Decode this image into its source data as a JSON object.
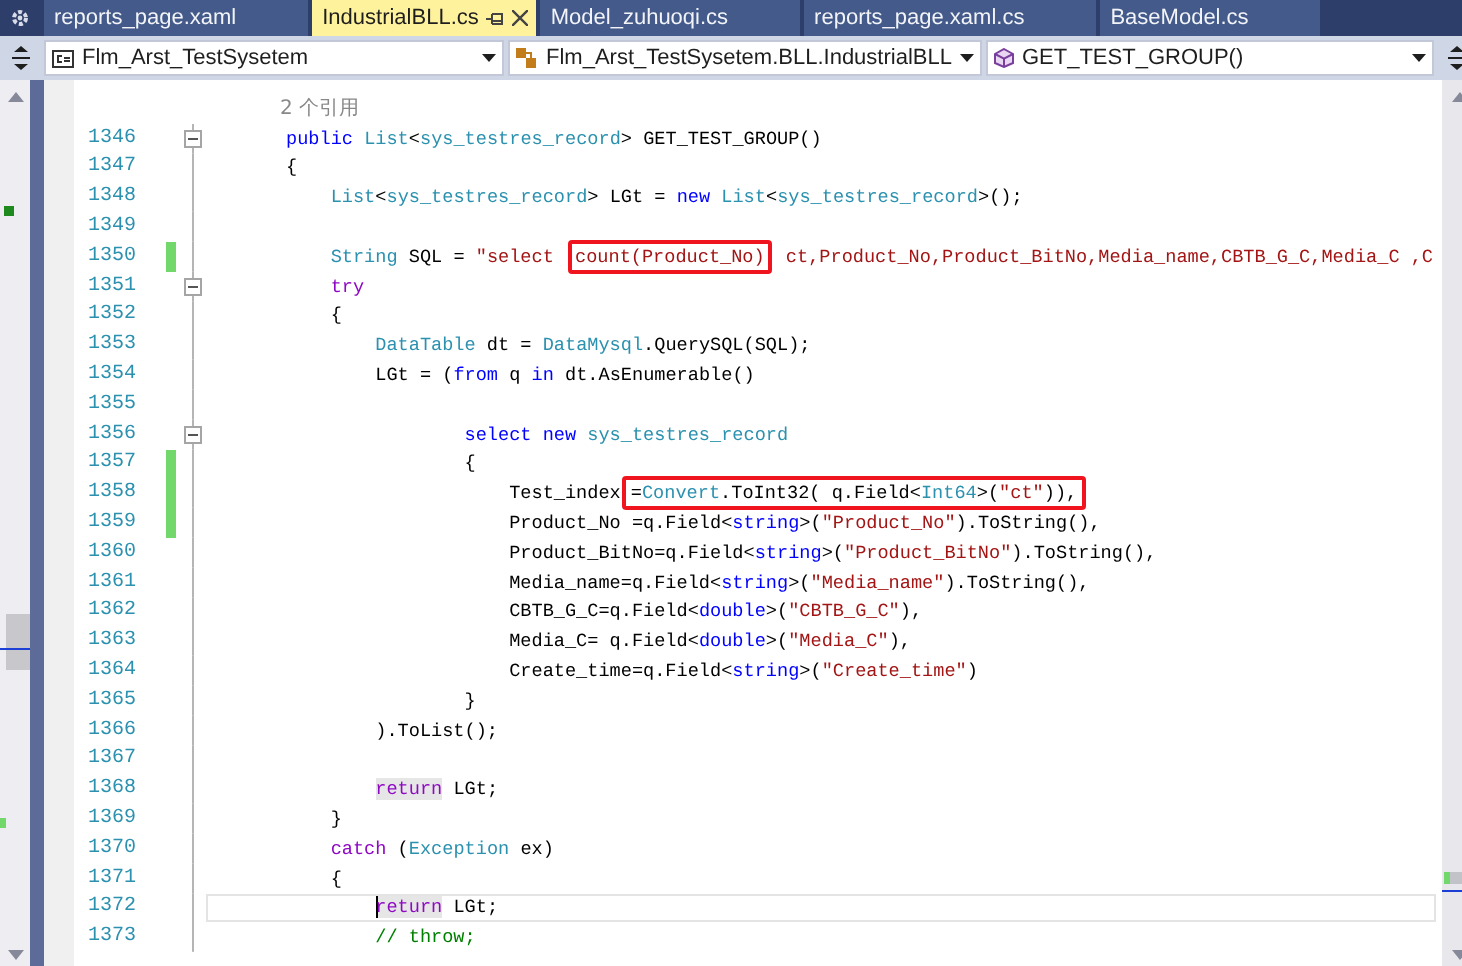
{
  "tabs": [
    {
      "label": "reports_page.xaml",
      "selected": false
    },
    {
      "label": "IndustrialBLL.cs",
      "selected": true
    },
    {
      "label": "Model_zuhuoqi.cs",
      "selected": false
    },
    {
      "label": "reports_page.xaml.cs",
      "selected": false
    },
    {
      "label": "BaseModel.cs",
      "selected": false
    }
  ],
  "navigation": {
    "project": "Flm_Arst_TestSysetem",
    "class": "Flm_Arst_TestSysetem.BLL.IndustrialBLL",
    "member": "GET_TEST_GROUP()"
  },
  "editor": {
    "codelens": "2 个引用",
    "lines": [
      {
        "number": "1346",
        "changed": false,
        "fold": true,
        "current": false,
        "tokens": [
          {
            "text": "public ",
            "kind": "keyword"
          },
          {
            "text": "List",
            "kind": "type"
          },
          {
            "text": "<",
            "kind": "plain"
          },
          {
            "text": "sys_testres_record",
            "kind": "type"
          },
          {
            "text": "> GET_TEST_GROUP()",
            "kind": "plain"
          }
        ]
      },
      {
        "number": "1347",
        "changed": false,
        "fold": false,
        "current": false,
        "tokens": [
          {
            "text": "{",
            "kind": "plain"
          }
        ]
      },
      {
        "number": "1348",
        "changed": false,
        "fold": false,
        "current": false,
        "tokens": [
          {
            "text": "    List",
            "kind": "type"
          },
          {
            "text": "<",
            "kind": "plain"
          },
          {
            "text": "sys_testres_record",
            "kind": "type"
          },
          {
            "text": "> LGt = ",
            "kind": "plain"
          },
          {
            "text": "new ",
            "kind": "keyword"
          },
          {
            "text": "List",
            "kind": "type"
          },
          {
            "text": "<",
            "kind": "plain"
          },
          {
            "text": "sys_testres_record",
            "kind": "type"
          },
          {
            "text": ">();",
            "kind": "plain"
          }
        ]
      },
      {
        "number": "1349",
        "changed": false,
        "fold": false,
        "current": false
      },
      {
        "number": "1350",
        "changed": true,
        "fold": false,
        "current": false,
        "tokens": [
          {
            "text": "    String",
            "kind": "type"
          },
          {
            "text": " SQL = ",
            "kind": "plain"
          },
          {
            "text": "\"select ",
            "kind": "string"
          },
          {
            "kind": "callout",
            "tokens": [
              {
                "text": "count(Product_No)",
                "kind": "string"
              }
            ]
          },
          {
            "text": " ct,Product_No,Product_BitNo,Media_name,CBTB_G_C,Media_C ,C",
            "kind": "string"
          }
        ]
      },
      {
        "number": "1351",
        "changed": false,
        "fold": true,
        "current": false,
        "tokens": [
          {
            "text": "    try",
            "kind": "control"
          }
        ]
      },
      {
        "number": "1352",
        "changed": false,
        "fold": false,
        "current": false,
        "tokens": [
          {
            "text": "    {",
            "kind": "plain"
          }
        ]
      },
      {
        "number": "1353",
        "changed": false,
        "fold": false,
        "current": false,
        "tokens": [
          {
            "text": "        DataTable",
            "kind": "type"
          },
          {
            "text": " dt = ",
            "kind": "plain"
          },
          {
            "text": "DataMysql",
            "kind": "type"
          },
          {
            "text": ".QuerySQL(SQL);",
            "kind": "plain"
          }
        ]
      },
      {
        "number": "1354",
        "changed": false,
        "fold": false,
        "current": false,
        "tokens": [
          {
            "text": "        LGt = (",
            "kind": "plain"
          },
          {
            "text": "from ",
            "kind": "keyword"
          },
          {
            "text": "q ",
            "kind": "plain"
          },
          {
            "text": "in ",
            "kind": "keyword"
          },
          {
            "text": "dt.AsEnumerable()",
            "kind": "plain"
          }
        ]
      },
      {
        "number": "1355",
        "changed": false,
        "fold": false,
        "current": false
      },
      {
        "number": "1356",
        "changed": false,
        "fold": true,
        "current": false,
        "tokens": [
          {
            "text": "                select new ",
            "kind": "keyword"
          },
          {
            "text": "sys_testres_record",
            "kind": "type"
          }
        ]
      },
      {
        "number": "1357",
        "changed": true,
        "fold": false,
        "current": false,
        "tokens": [
          {
            "text": "                {",
            "kind": "plain"
          }
        ]
      },
      {
        "number": "1358",
        "changed": true,
        "fold": false,
        "current": false,
        "tokens": [
          {
            "text": "                    Test_index",
            "kind": "plain"
          },
          {
            "kind": "callout",
            "tokens": [
              {
                "text": "=",
                "kind": "plain"
              },
              {
                "text": "Convert",
                "kind": "type"
              },
              {
                "text": ".ToInt32( q.Field<",
                "kind": "plain"
              },
              {
                "text": "Int64",
                "kind": "type"
              },
              {
                "text": ">(",
                "kind": "plain"
              },
              {
                "text": "\"ct\"",
                "kind": "string"
              },
              {
                "text": ")),",
                "kind": "plain"
              }
            ]
          }
        ]
      },
      {
        "number": "1359",
        "changed": true,
        "fold": false,
        "current": false,
        "tokens": [
          {
            "text": "                    Product_No =q.Field<",
            "kind": "plain"
          },
          {
            "text": "string",
            "kind": "keyword"
          },
          {
            "text": ">(",
            "kind": "plain"
          },
          {
            "text": "\"Product_No\"",
            "kind": "string"
          },
          {
            "text": ").ToString(),",
            "kind": "plain"
          }
        ]
      },
      {
        "number": "1360",
        "changed": false,
        "fold": false,
        "current": false,
        "tokens": [
          {
            "text": "                    Product_BitNo=q.Field<",
            "kind": "plain"
          },
          {
            "text": "string",
            "kind": "keyword"
          },
          {
            "text": ">(",
            "kind": "plain"
          },
          {
            "text": "\"Product_BitNo\"",
            "kind": "string"
          },
          {
            "text": ").ToString(),",
            "kind": "plain"
          }
        ]
      },
      {
        "number": "1361",
        "changed": false,
        "fold": false,
        "current": false,
        "tokens": [
          {
            "text": "                    Media_name=q.Field<",
            "kind": "plain"
          },
          {
            "text": "string",
            "kind": "keyword"
          },
          {
            "text": ">(",
            "kind": "plain"
          },
          {
            "text": "\"Media_name\"",
            "kind": "string"
          },
          {
            "text": ").ToString(),",
            "kind": "plain"
          }
        ]
      },
      {
        "number": "1362",
        "changed": false,
        "fold": false,
        "current": false,
        "tokens": [
          {
            "text": "                    CBTB_G_C=q.Field<",
            "kind": "plain"
          },
          {
            "text": "double",
            "kind": "keyword"
          },
          {
            "text": ">(",
            "kind": "plain"
          },
          {
            "text": "\"CBTB_G_C\"",
            "kind": "string"
          },
          {
            "text": "),",
            "kind": "plain"
          }
        ]
      },
      {
        "number": "1363",
        "changed": false,
        "fold": false,
        "current": false,
        "tokens": [
          {
            "text": "                    Media_C= q.Field<",
            "kind": "plain"
          },
          {
            "text": "double",
            "kind": "keyword"
          },
          {
            "text": ">(",
            "kind": "plain"
          },
          {
            "text": "\"Media_C\"",
            "kind": "string"
          },
          {
            "text": "),",
            "kind": "plain"
          }
        ]
      },
      {
        "number": "1364",
        "changed": false,
        "fold": false,
        "current": false,
        "tokens": [
          {
            "text": "                    Create_time=q.Field<",
            "kind": "plain"
          },
          {
            "text": "string",
            "kind": "keyword"
          },
          {
            "text": ">(",
            "kind": "plain"
          },
          {
            "text": "\"Create_time\"",
            "kind": "string"
          },
          {
            "text": ")",
            "kind": "plain"
          }
        ]
      },
      {
        "number": "1365",
        "changed": false,
        "fold": false,
        "current": false,
        "tokens": [
          {
            "text": "                }",
            "kind": "plain"
          }
        ]
      },
      {
        "number": "1366",
        "changed": false,
        "fold": false,
        "current": false,
        "tokens": [
          {
            "text": "        ).ToList();",
            "kind": "plain"
          }
        ]
      },
      {
        "number": "1367",
        "changed": false,
        "fold": false,
        "current": false
      },
      {
        "number": "1368",
        "changed": false,
        "fold": false,
        "current": false,
        "tokens": [
          {
            "text": "        return",
            "kind": "control-ref"
          },
          {
            "text": " LGt;",
            "kind": "plain"
          }
        ]
      },
      {
        "number": "1369",
        "changed": false,
        "fold": false,
        "current": false,
        "tokens": [
          {
            "text": "    }",
            "kind": "plain"
          }
        ]
      },
      {
        "number": "1370",
        "changed": false,
        "fold": false,
        "current": false,
        "tokens": [
          {
            "text": "    catch ",
            "kind": "control"
          },
          {
            "text": "(",
            "kind": "plain"
          },
          {
            "text": "Exception",
            "kind": "type"
          },
          {
            "text": " ex)",
            "kind": "plain"
          }
        ]
      },
      {
        "number": "1371",
        "changed": false,
        "fold": false,
        "current": false,
        "tokens": [
          {
            "text": "    {",
            "kind": "plain"
          }
        ]
      },
      {
        "number": "1372",
        "changed": false,
        "fold": false,
        "current": true,
        "tokens": [
          {
            "text": "        return",
            "kind": "control-ref"
          },
          {
            "text": " LGt;",
            "kind": "plain"
          }
        ]
      },
      {
        "number": "1373",
        "changed": false,
        "fold": false,
        "current": false,
        "tokens": [
          {
            "text": "        // throw;",
            "kind": "comment"
          }
        ]
      }
    ]
  }
}
